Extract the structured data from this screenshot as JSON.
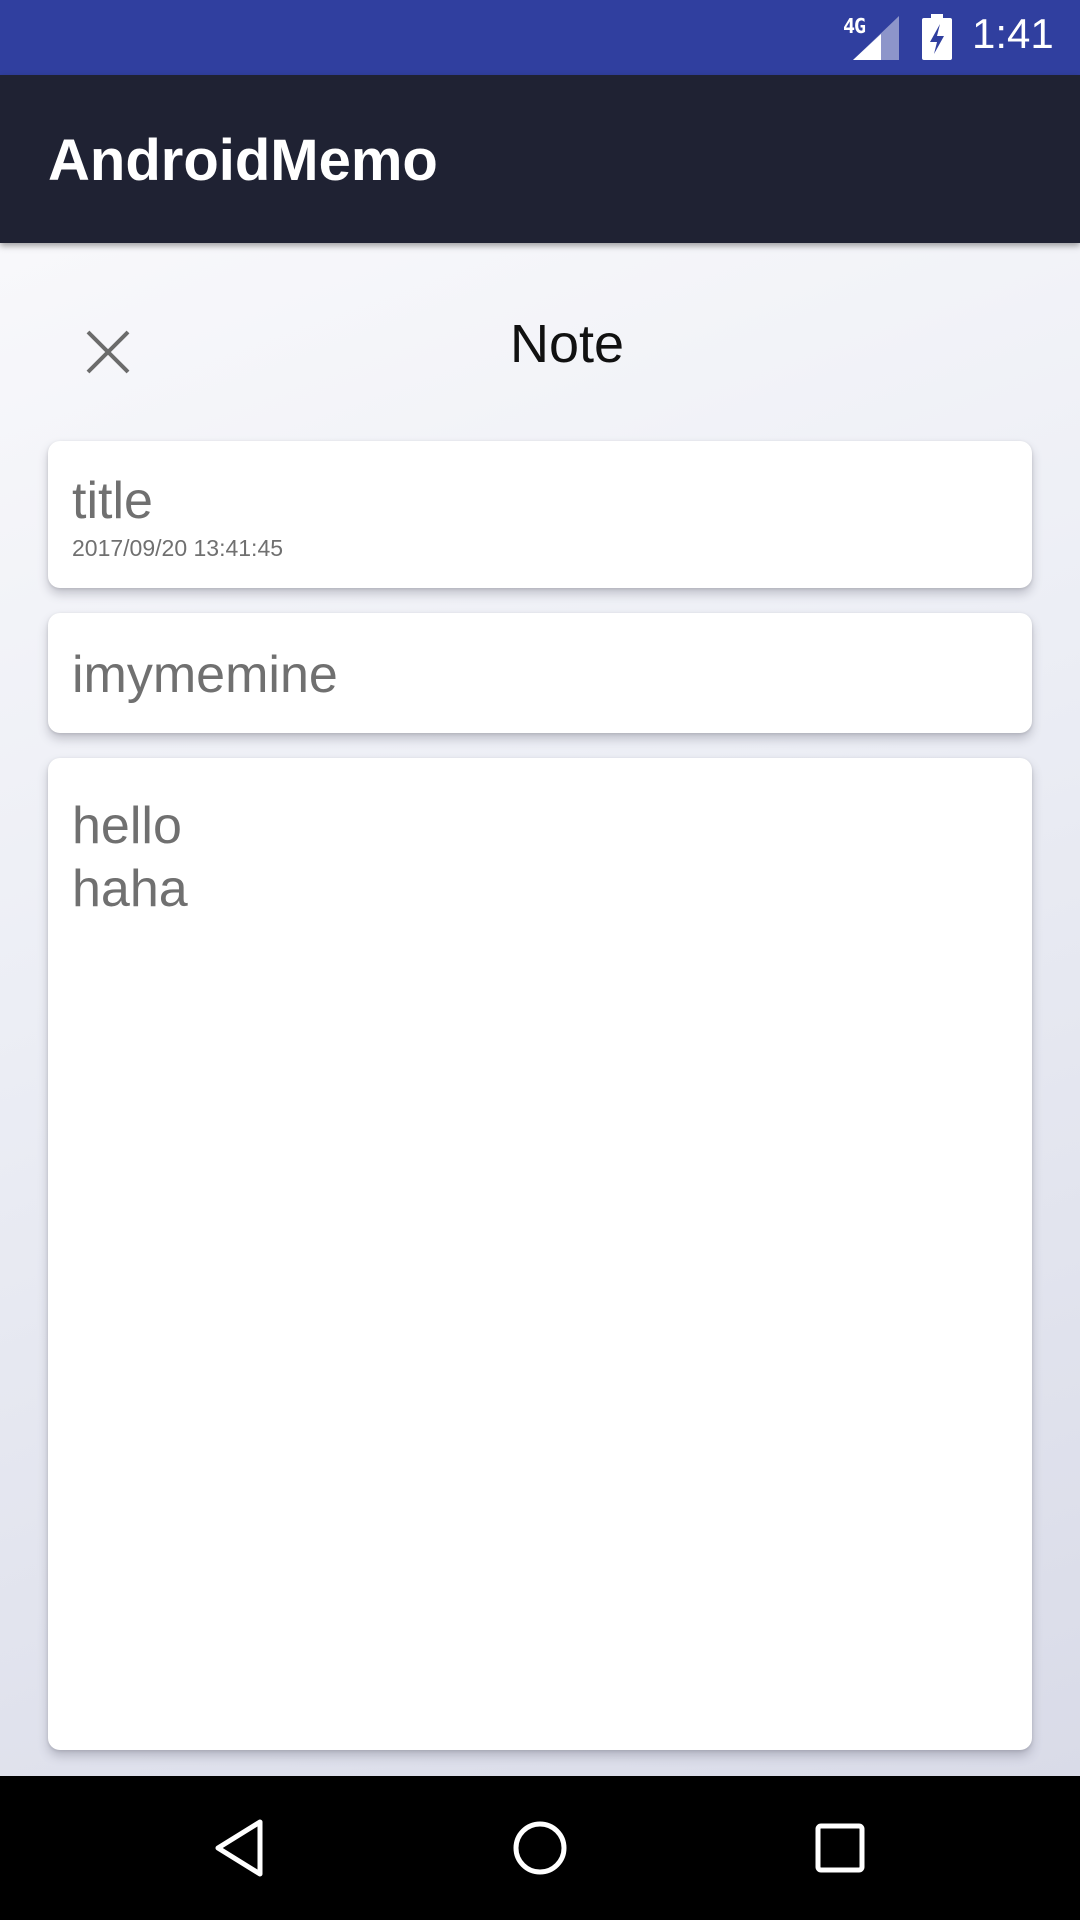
{
  "status_bar": {
    "network": "4G",
    "time": "1:41",
    "background_color": "#303f9f"
  },
  "app_bar": {
    "title": "AndroidMemo",
    "background_color": "#1f2233"
  },
  "note_dialog": {
    "close_icon": "close-icon",
    "heading": "Note",
    "title_field": {
      "value": "title",
      "date": "2017/09/20 13:41:45"
    },
    "author_field": {
      "value": "imymemine"
    },
    "body_field": {
      "lines": [
        "hello",
        "haha"
      ]
    }
  },
  "nav_bar": {
    "back_icon": "back-triangle-icon",
    "home_icon": "home-circle-icon",
    "recents_icon": "recents-square-icon"
  }
}
